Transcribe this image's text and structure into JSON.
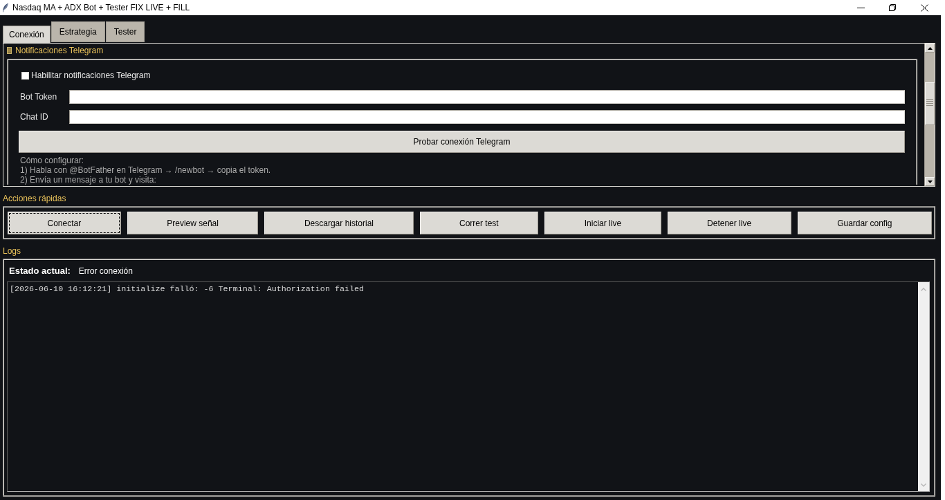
{
  "window": {
    "title": "Nasdaq MA + ADX Bot + Tester FIX LIVE + FILL"
  },
  "tabs": [
    {
      "label": "Conexión",
      "selected": true
    },
    {
      "label": "Estrategia",
      "selected": false
    },
    {
      "label": "Tester",
      "selected": false
    }
  ],
  "telegram": {
    "title": "Notificaciones Telegram",
    "enable": {
      "label": "Habilitar notificaciones Telegram",
      "checked": false
    },
    "fields": [
      {
        "label": "Bot Token"
      },
      {
        "label": "Chat ID"
      }
    ],
    "test_button": "Probar conexión Telegram",
    "help_lines": [
      "Cómo configurar:",
      "1) Habla con @BotFather en Telegram → /newbot → copia el token.",
      "2) Envía un mensaje a tu bot y visita:"
    ]
  },
  "quick_actions": {
    "title": "Acciones rápidas",
    "buttons": [
      {
        "label": "Conectar",
        "focused": true
      },
      {
        "label": "Preview señal",
        "focused": false
      },
      {
        "label": "Descargar historial",
        "focused": false
      },
      {
        "label": "Correr test",
        "focused": false
      },
      {
        "label": "Iniciar live",
        "focused": false
      },
      {
        "label": "Detener live",
        "focused": false
      },
      {
        "label": "Guardar config",
        "focused": false
      }
    ]
  },
  "logs": {
    "title": "Logs",
    "status_label": "Estado actual:",
    "status_value": "Error conexión",
    "lines": [
      "[2026-06-10 16:12:21] initialize falló: -6 Terminal: Authorization failed"
    ]
  }
}
